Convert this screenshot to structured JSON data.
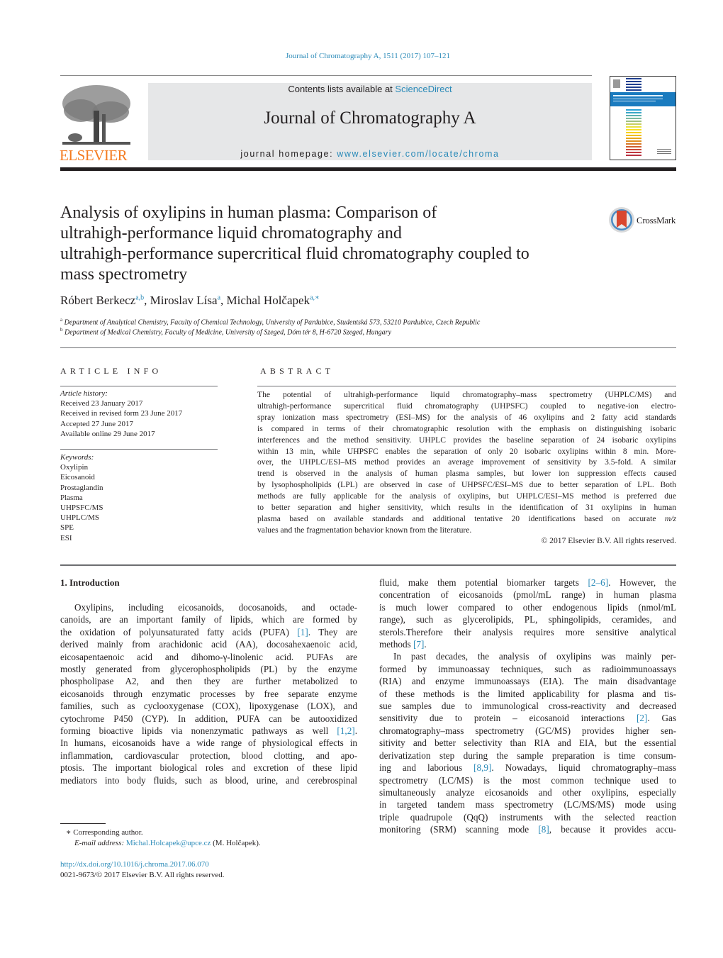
{
  "header": {
    "journal_ref": "Journal of Chromatography A, 1511 (2017) 107–121",
    "contents_prefix": "Contents lists available at ",
    "contents_link": "ScienceDirect",
    "journal_title": "Journal of Chromatography A",
    "homepage_prefix": "journal homepage: ",
    "homepage_link": "www.elsevier.com/locate/chroma",
    "publisher_logo_text": "ELSEVIER",
    "crossmark_label": "CrossMark",
    "colors": {
      "link": "#2a8ab8",
      "elsevier_orange": "#f47b20",
      "banner_bg": "#e6e7e8"
    }
  },
  "article": {
    "title_lines": [
      "Analysis of oxylipins in human plasma: Comparison of",
      "ultrahigh-performance liquid chromatography and",
      "ultrahigh-performance supercritical fluid chromatography coupled to",
      "mass spectrometry"
    ],
    "authors": [
      {
        "name": "Róbert Berkecz",
        "sup": "a,b"
      },
      {
        "name": "Miroslav Lísa",
        "sup": "a"
      },
      {
        "name": "Michal Holčapek",
        "sup": "a,∗"
      }
    ],
    "affiliations": [
      {
        "mark": "a",
        "text": "Department of Analytical Chemistry, Faculty of Chemical Technology, University of Pardubice, Studentská 573, 53210 Pardubice, Czech Republic"
      },
      {
        "mark": "b",
        "text": "Department of Medical Chemistry, Faculty of Medicine, University of Szeged, Dóm tér 8, H-6720 Szeged, Hungary"
      }
    ]
  },
  "article_info": {
    "heading": "ARTICLE INFO",
    "history_label": "Article history:",
    "history": [
      "Received 23 January 2017",
      "Received in revised form 23 June 2017",
      "Accepted 27 June 2017",
      "Available online 29 June 2017"
    ],
    "keywords_label": "Keywords:",
    "keywords": [
      "Oxylipin",
      "Eicosanoid",
      "Prostaglandin",
      "Plasma",
      "UHPSFC/MS",
      "UHPLC/MS",
      "SPE",
      "ESI"
    ]
  },
  "abstract": {
    "heading": "ABSTRACT",
    "lines": [
      "The potential of ultrahigh-performance liquid chromatography–mass spectrometry (UHPLC/MS) and",
      "ultrahigh-performance supercritical fluid chromatography (UHPSFC) coupled to negative-ion electro-",
      "spray ionization mass spectrometry (ESI–MS) for the analysis of 46 oxylipins and 2 fatty acid standards",
      "is compared in terms of their chromatographic resolution with the emphasis on distinguishing isobaric",
      "interferences and the method sensitivity. UHPLC provides the baseline separation of 24 isobaric oxylipins",
      "within 13 min, while UHPSFC enables the separation of only 20 isobaric oxylipins within 8 min. More-",
      "over, the UHPLC/ESI–MS method provides an average improvement of sensitivity by 3.5-fold. A similar",
      "trend is observed in the analysis of human plasma samples, but lower ion suppression effects caused",
      "by lysophospholipids (LPL) are observed in case of UHPSFC/ESI–MS due to better separation of LPL. Both",
      "methods are fully applicable for the analysis of oxylipins, but UHPLC/ESI–MS method is preferred due",
      "to better separation and higher sensitivity, which results in the identification of 31 oxylipins in human",
      "plasma based on available standards and additional tentative 20 identifications based on accurate m/z",
      "values and the fragmentation behavior known from the literature."
    ],
    "copyright": "© 2017 Elsevier B.V. All rights reserved."
  },
  "introduction": {
    "heading": "1.  Introduction",
    "left_lines": [
      "Oxylipins, including eicosanoids, docosanoids, and octade-",
      "canoids, are an important family of lipids, which are formed by",
      "the oxidation of polyunsaturated fatty acids (PUFA) [1]. They are",
      "derived mainly from arachidonic acid (AA), docosahexaenoic acid,",
      "eicosapentaenoic acid and dihomo-γ-linolenic acid. PUFAs are",
      "mostly generated from glycerophospholipids (PL) by the enzyme",
      "phospholipase A2, and then they are further metabolized to",
      "eicosanoids through enzymatic processes by free separate enzyme",
      "families, such as cyclooxygenase (COX), lipoxygenase (LOX), and",
      "cytochrome P450 (CYP). In addition, PUFA can be autooxidized",
      "forming bioactive lipids via nonenzymatic pathways as well [1,2].",
      "In humans, eicosanoids have a wide range of physiological effects in",
      "inflammation, cardiovascular protection, blood clotting, and apo-",
      "ptosis. The important biological roles and excretion of these lipid",
      "mediators into body fluids, such as blood, urine, and cerebrospinal"
    ],
    "right_lines": [
      "fluid, make them potential biomarker targets [2–6]. However, the",
      "concentration of eicosanoids (pmol/mL range) in human plasma",
      "is much lower compared to other endogenous lipids (nmol/mL",
      "range), such as glycerolipids, PL, sphingolipids, ceramides, and",
      "sterols.Therefore their analysis requires more sensitive analytical",
      "methods [7].",
      "In past decades, the analysis of oxylipins was mainly per-",
      "formed by immunoassay techniques, such as radioimmunoassays",
      "(RIA) and enzyme immunoassays (EIA). The main disadvantage",
      "of these methods is the limited applicability for plasma and tis-",
      "sue samples due to immunological cross-reactivity and decreased",
      "sensitivity due to protein – eicosanoid interactions [2]. Gas",
      "chromatography–mass spectrometry (GC/MS) provides higher sen-",
      "sitivity and better selectivity than RIA and EIA, but the essential",
      "derivatization step during the sample preparation is time consum-",
      "ing and laborious [8,9]. Nowadays, liquid chromatography–mass",
      "spectrometry (LC/MS) is the most common technique used to",
      "simultaneously analyze eicosanoids and other oxylipins, especially",
      "in targeted tandem mass spectrometry (LC/MS/MS) mode using",
      "triple quadrupole (QqQ) instruments with the selected reaction",
      "monitoring (SRM) scanning mode [8], because it provides accu-"
    ]
  },
  "footnotes": {
    "corresponding_mark": "∗",
    "corresponding_text": "Corresponding author.",
    "email_label": "E-mail address:",
    "email": "Michal.Holcapek@upce.cz",
    "email_suffix": " (M. Holčapek).",
    "doi": "http://dx.doi.org/10.1016/j.chroma.2017.06.070",
    "issn_copyright": "0021-9673/© 2017 Elsevier B.V. All rights reserved."
  }
}
